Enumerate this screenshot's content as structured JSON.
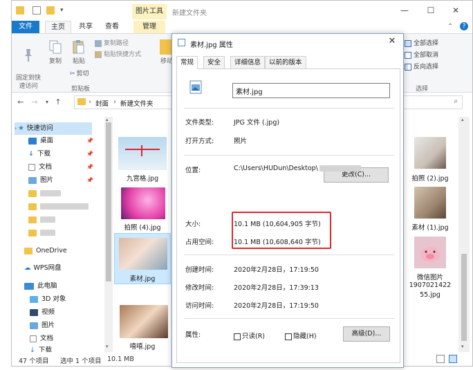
{
  "explorer": {
    "window_title": "新建文件夹",
    "context_tab_header": "图片工具",
    "tabs": {
      "file": "文件",
      "home": "主页",
      "share": "共享",
      "view": "查看",
      "manage": "管理"
    },
    "ribbon": {
      "pin_quick_access": "固定到快\n速访问",
      "copy": "复制",
      "paste": "粘贴",
      "copy_path": "复制路径",
      "paste_shortcut": "粘贴快捷方式",
      "cut": "剪切",
      "move_to": "移动",
      "clipboard_group": "剪贴板",
      "select_all": "全部选择",
      "select_none": "全部取消",
      "invert_selection": "反向选择",
      "select_group": "选择"
    },
    "breadcrumb": {
      "item1": "封面",
      "item2": "新建文件夹"
    },
    "nav": {
      "quick_access": "快速访问",
      "desktop": "桌面",
      "downloads": "下载",
      "documents": "文档",
      "pictures": "图片",
      "onedrive": "OneDrive",
      "wps": "WPS网盘",
      "this_pc": "此电脑",
      "objects3d": "3D 对象",
      "videos": "视频",
      "pc_pictures": "图片",
      "pc_documents": "文档",
      "pc_downloads": "下载"
    },
    "files": {
      "f1": "九宫格.jpg",
      "f2": "拍照 (4).jpg",
      "f3": "素材.jpg",
      "f4": "嘻嘻.jpg",
      "r1": "拍照 (2).jpg",
      "r2": "素材 (1).jpg",
      "r3a": "微信图片",
      "r3b": "1907021422",
      "r3c": "55.jpg"
    },
    "status": {
      "count": "47 个项目",
      "selected": "选中 1 个项目",
      "size": "10.1 MB"
    }
  },
  "dialog": {
    "title": "素材.jpg 属性",
    "tabs": {
      "general": "常规",
      "security": "安全",
      "details": "详细信息",
      "previous": "以前的版本"
    },
    "filename": "素材.jpg",
    "labels": {
      "type": "文件类型:",
      "opens_with": "打开方式:",
      "location": "位置:",
      "size": "大小:",
      "size_on_disk": "占用空间:",
      "created": "创建时间:",
      "modified": "修改时间:",
      "accessed": "访问时间:",
      "attributes": "属性:"
    },
    "values": {
      "type": "JPG 文件 (.jpg)",
      "opens_with": "照片",
      "location": "C:\\Users\\HUDun\\Desktop\\",
      "size": "10.1 MB (10,604,905 字节)",
      "size_on_disk": "10.1 MB (10,608,640 字节)",
      "created": "2020年2月28日，17:19:50",
      "modified": "2020年2月28日，17:39:13",
      "accessed": "2020年2月28日，17:19:50"
    },
    "buttons": {
      "change": "更改(C)...",
      "advanced": "高级(D)..."
    },
    "checks": {
      "readonly": "只读(R)",
      "hidden": "隐藏(H)"
    }
  },
  "colors": {
    "accent": "#1979ca",
    "highlight": "#e0262b",
    "context_tab": "#fdf2bf"
  }
}
